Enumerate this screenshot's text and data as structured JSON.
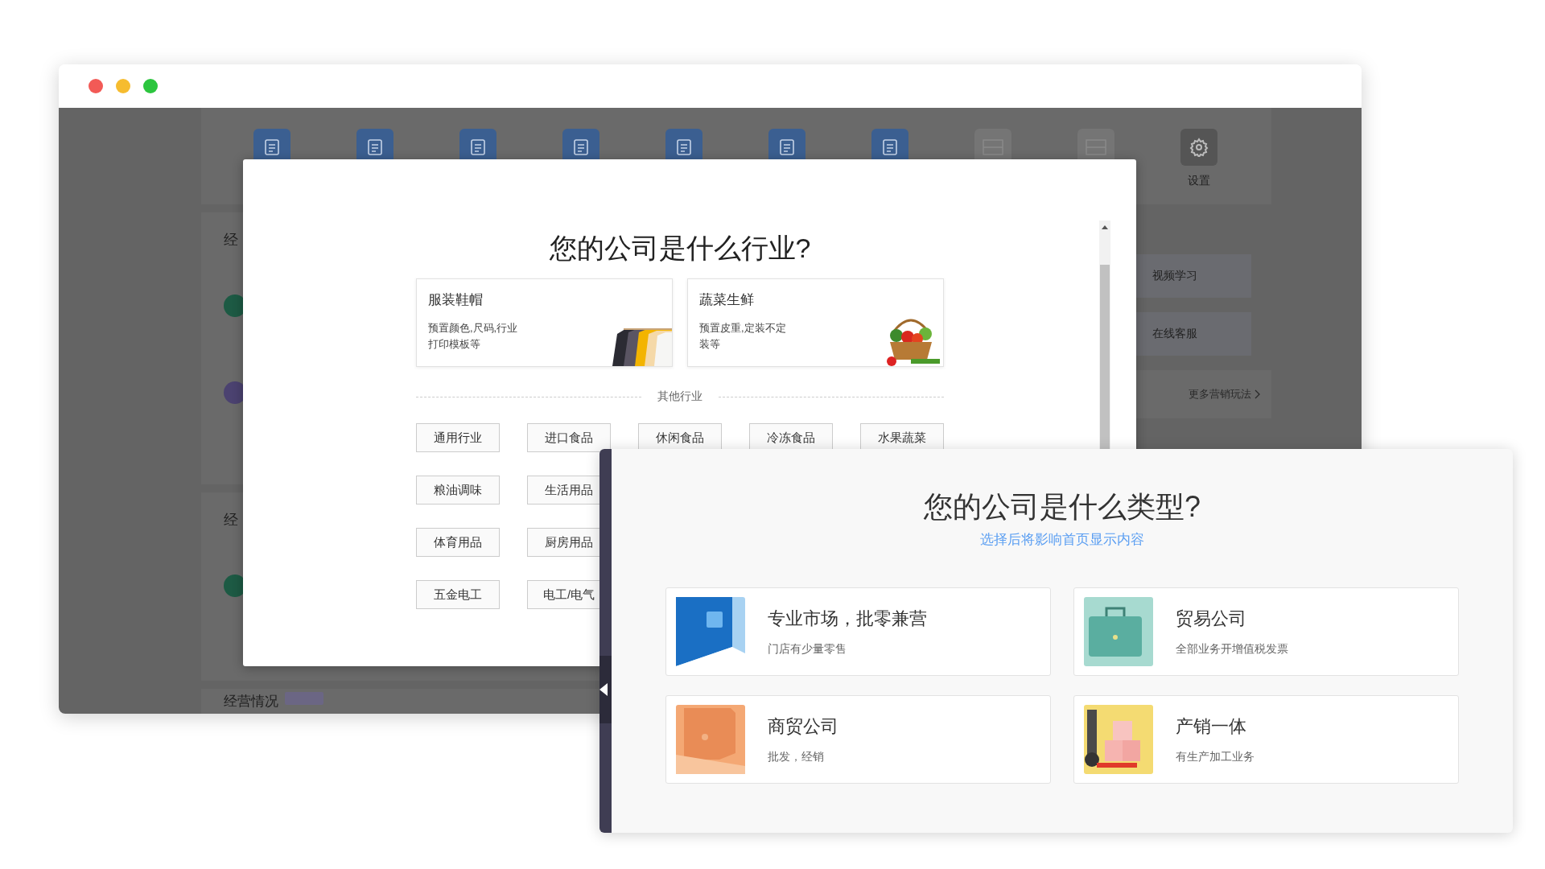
{
  "browser": {
    "toolbar": [
      {
        "kind": "feature"
      },
      {
        "kind": "feature"
      },
      {
        "kind": "feature"
      },
      {
        "kind": "feature"
      },
      {
        "kind": "feature"
      },
      {
        "kind": "feature"
      },
      {
        "kind": "feature"
      },
      {
        "kind": "placeholder"
      },
      {
        "kind": "placeholder"
      },
      {
        "kind": "settings",
        "label": "设置"
      }
    ],
    "sections": [
      {
        "heading": "经",
        "markers": [
          {
            "color": "#1d5a44"
          },
          {
            "color": "#4b4270"
          }
        ]
      },
      {
        "heading": "经",
        "markers": [
          {
            "color": "#1d5a44"
          }
        ]
      }
    ],
    "footer_heading": "经营情况",
    "shortcuts": [
      "视频学习",
      "在线客服"
    ],
    "more_link": "更多营销玩法"
  },
  "industry_dialog": {
    "title": "您的公司是什么行业?",
    "featured": [
      {
        "title": "服装鞋帽",
        "lines": [
          "预置颜色,尺码,行业",
          "打印模板等"
        ],
        "kind": "clothing"
      },
      {
        "title": "蔬菜生鲜",
        "lines": [
          "预置皮重,定装不定",
          "装等"
        ],
        "kind": "vegetables"
      }
    ],
    "divider": "其他行业",
    "options": [
      [
        "通用行业",
        "进口食品",
        "休闲食品",
        "冷冻食品",
        "水果蔬菜"
      ],
      [
        "粮油调味",
        "生活用品"
      ],
      [
        "体育用品",
        "厨房用品"
      ],
      [
        "五金电工",
        "电工/电气"
      ]
    ]
  },
  "type_dialog": {
    "title": "您的公司是什么类型?",
    "subtitle": "选择后将影响首页显示内容",
    "types": [
      {
        "title": "专业市场，批零兼营",
        "description": "门店有少量零售",
        "kind": "market"
      },
      {
        "title": "贸易公司",
        "description": "全部业务开增值税发票",
        "kind": "briefcase"
      },
      {
        "title": "商贸公司",
        "description": "批发，经销",
        "kind": "folder"
      },
      {
        "title": "产销一体",
        "description": "有生产加工业务",
        "kind": "forklift"
      }
    ]
  }
}
